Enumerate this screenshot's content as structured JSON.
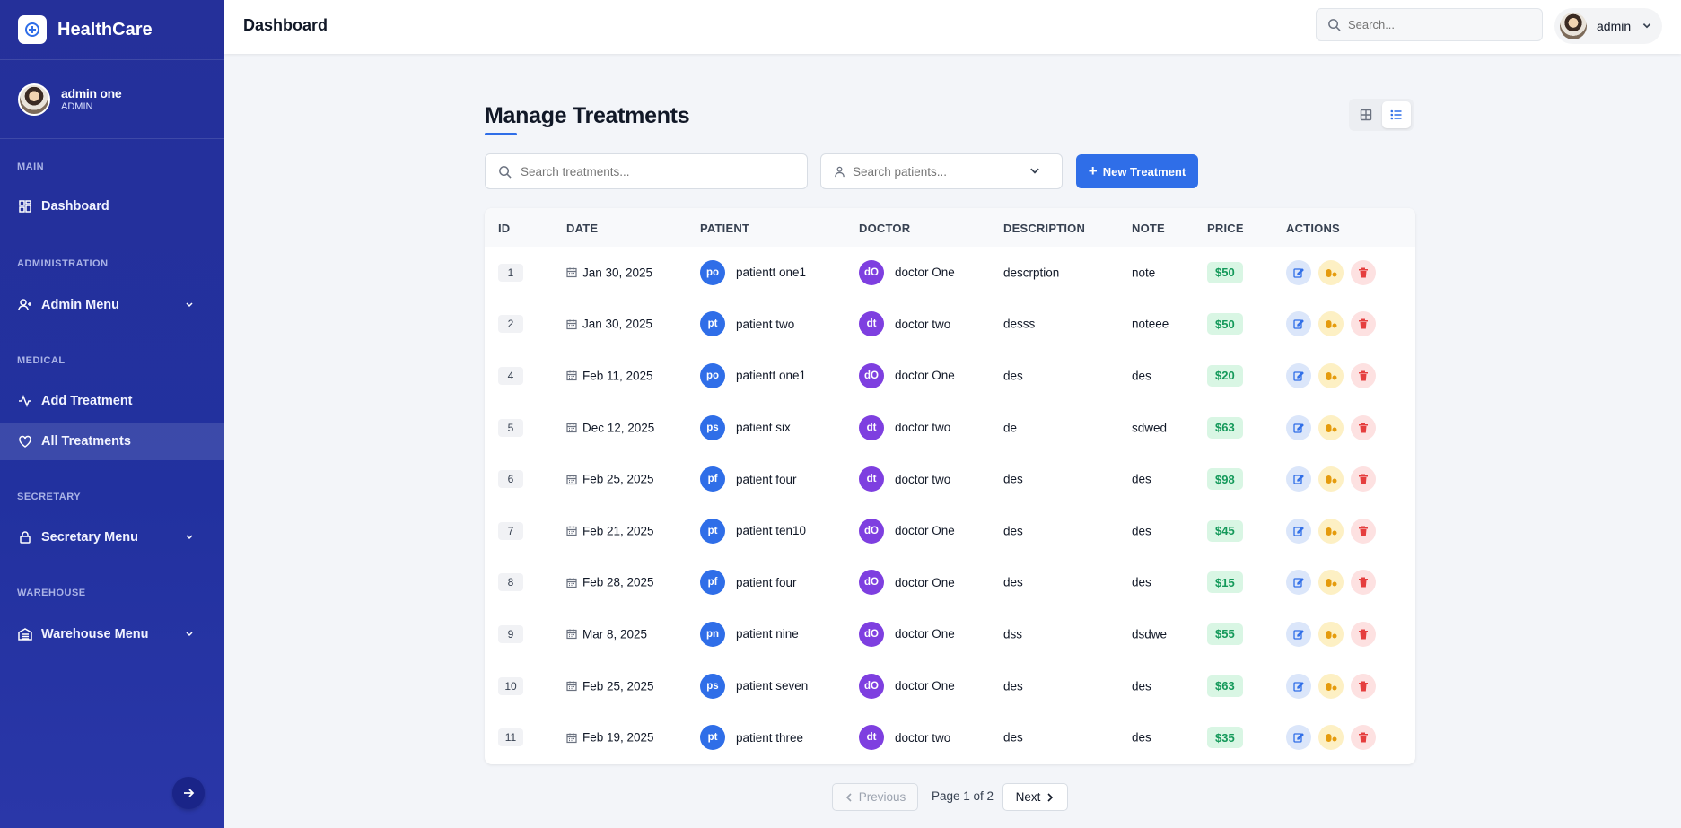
{
  "brand": {
    "name": "HealthCare"
  },
  "user": {
    "name": "admin one",
    "role": "ADMIN"
  },
  "sidebar": {
    "sections": [
      {
        "title": "MAIN"
      },
      {
        "title": "ADMINISTRATION"
      },
      {
        "title": "MEDICAL"
      },
      {
        "title": "SECRETARY"
      },
      {
        "title": "WAREHOUSE"
      }
    ],
    "items": [
      {
        "label": "Dashboard",
        "icon": "grid-icon"
      },
      {
        "label": "Admin Menu",
        "icon": "user-plus-icon"
      },
      {
        "label": "Add Treatment",
        "icon": "activity-icon"
      },
      {
        "label": "All Treatments",
        "icon": "heart-icon",
        "active": true
      },
      {
        "label": "Secretary Menu",
        "icon": "lock-icon"
      },
      {
        "label": "Warehouse Menu",
        "icon": "warehouse-icon"
      }
    ]
  },
  "topbar": {
    "title": "Dashboard",
    "search_placeholder": "Search...",
    "user_name": "admin"
  },
  "main": {
    "title": "Manage Treatments",
    "treatment_search_placeholder": "Search treatments...",
    "patient_search_placeholder": "Search patients...",
    "new_button_label": "New Treatment"
  },
  "table": {
    "headers": [
      "ID",
      "DATE",
      "PATIENT",
      "DOCTOR",
      "DESCRIPTION",
      "NOTE",
      "PRICE",
      "ACTIONS"
    ],
    "rows": [
      {
        "id": "1",
        "date": "Jan 30, 2025",
        "patient_initials": "po",
        "patient": "patientt one1",
        "doctor_initials": "dO",
        "doctor": "doctor One",
        "description": "descrption",
        "note": "note",
        "price": "$50"
      },
      {
        "id": "2",
        "date": "Jan 30, 2025",
        "patient_initials": "pt",
        "patient": "patient two",
        "doctor_initials": "dt",
        "doctor": "doctor two",
        "description": "desss",
        "note": "noteee",
        "price": "$50"
      },
      {
        "id": "4",
        "date": "Feb 11, 2025",
        "patient_initials": "po",
        "patient": "patientt one1",
        "doctor_initials": "dO",
        "doctor": "doctor One",
        "description": "des",
        "note": "des",
        "price": "$20"
      },
      {
        "id": "5",
        "date": "Dec 12, 2025",
        "patient_initials": "ps",
        "patient": "patient six",
        "doctor_initials": "dt",
        "doctor": "doctor two",
        "description": "de",
        "note": "sdwed",
        "price": "$63"
      },
      {
        "id": "6",
        "date": "Feb 25, 2025",
        "patient_initials": "pf",
        "patient": "patient four",
        "doctor_initials": "dt",
        "doctor": "doctor two",
        "description": "des",
        "note": "des",
        "price": "$98"
      },
      {
        "id": "7",
        "date": "Feb 21, 2025",
        "patient_initials": "pt",
        "patient": "patient ten10",
        "doctor_initials": "dO",
        "doctor": "doctor One",
        "description": "des",
        "note": "des",
        "price": "$45"
      },
      {
        "id": "8",
        "date": "Feb 28, 2025",
        "patient_initials": "pf",
        "patient": "patient four",
        "doctor_initials": "dO",
        "doctor": "doctor One",
        "description": "des",
        "note": "des",
        "price": "$15"
      },
      {
        "id": "9",
        "date": "Mar 8, 2025",
        "patient_initials": "pn",
        "patient": "patient nine",
        "doctor_initials": "dO",
        "doctor": "doctor One",
        "description": "dss",
        "note": "dsdwe",
        "price": "$55"
      },
      {
        "id": "10",
        "date": "Feb 25, 2025",
        "patient_initials": "ps",
        "patient": "patient seven",
        "doctor_initials": "dO",
        "doctor": "doctor One",
        "description": "des",
        "note": "des",
        "price": "$63"
      },
      {
        "id": "11",
        "date": "Feb 19, 2025",
        "patient_initials": "pt",
        "patient": "patient three",
        "doctor_initials": "dt",
        "doctor": "doctor two",
        "description": "des",
        "note": "des",
        "price": "$35"
      }
    ]
  },
  "pagination": {
    "prev_label": "Previous",
    "info": "Page 1 of 2",
    "next_label": "Next"
  },
  "colors": {
    "sidebar": "#25309a",
    "accent": "#2f6ee8",
    "doctor": "#7e3fe0",
    "price_bg": "#d9f6e4",
    "price_text": "#14995a"
  }
}
